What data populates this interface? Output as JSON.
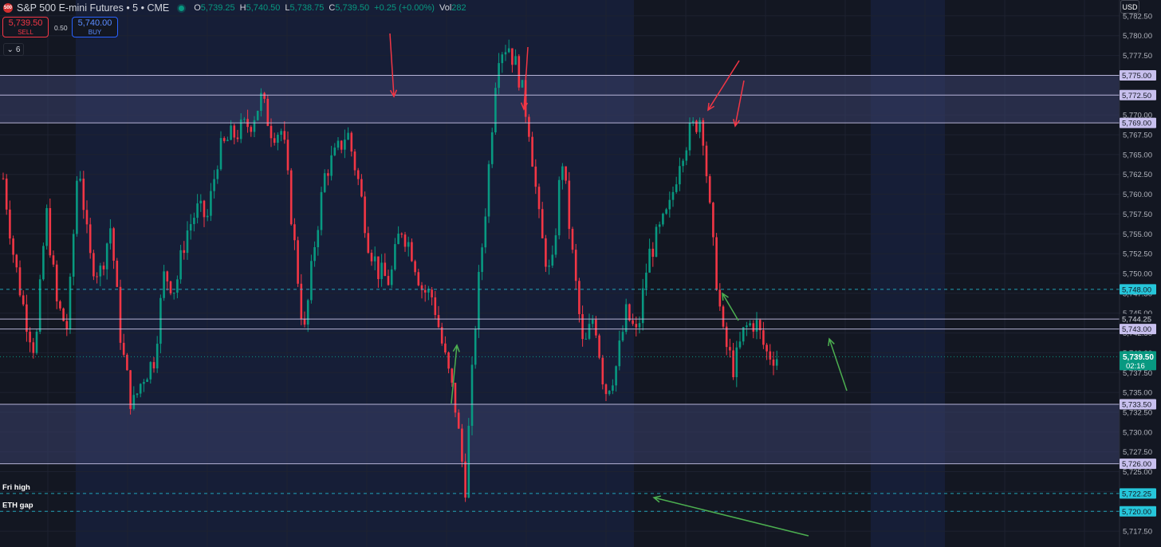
{
  "header": {
    "logo_text": "500",
    "symbol_title": "S&P 500 E-mini Futures • 5 • CME",
    "ohlc": {
      "o_label": "O",
      "o": "5,739.25",
      "h_label": "H",
      "h": "5,740.50",
      "l_label": "L",
      "l": "5,738.75",
      "c_label": "C",
      "c": "5,739.50",
      "change": "+0.25 (+0.00%)",
      "vol_label": "Vol",
      "vol": "282"
    }
  },
  "trade": {
    "sell_price": "5,739.50",
    "sell_label": "SELL",
    "spread": "0.50",
    "buy_price": "5,740.00",
    "buy_label": "BUY"
  },
  "indicators_toggle": {
    "count": "6"
  },
  "currency": "USD",
  "colors": {
    "bg": "#131722",
    "session": "#161e37",
    "up": "#089981",
    "down": "#f23645",
    "zone": "#3b3f6a",
    "level_line": "#c5c2e6",
    "dashed": "#26c6da",
    "arrow_red": "#f23645",
    "arrow_green": "#4caf50",
    "label_purple": "#c8c0ee",
    "label_teal": "#22ab94"
  },
  "chart_data": {
    "type": "candlestick",
    "instrument": "S&P 500 E-mini Futures",
    "timeframe": "5",
    "exchange": "CME",
    "ylim": [
      5715.5,
      5784.5
    ],
    "y_ticks": [
      "5,717.50",
      "5,720.00",
      "5,722.50",
      "5,725.00",
      "5,727.50",
      "5,730.00",
      "5,732.50",
      "5,735.00",
      "5,737.50",
      "5,740.00",
      "5,742.50",
      "5,745.00",
      "5,747.50",
      "5,750.00",
      "5,752.50",
      "5,755.00",
      "5,757.50",
      "5,760.00",
      "5,762.50",
      "5,765.00",
      "5,767.50",
      "5,770.00",
      "5,772.50",
      "5,775.00",
      "5,777.50",
      "5,780.00",
      "5,782.50"
    ],
    "y_tick_values": [
      5717.5,
      5720,
      5722.5,
      5725,
      5727.5,
      5730,
      5732.5,
      5735,
      5737.5,
      5740,
      5742.5,
      5745,
      5747.5,
      5750,
      5752.5,
      5755,
      5757.5,
      5760,
      5762.5,
      5765,
      5767.5,
      5770,
      5772.5,
      5775,
      5777.5,
      5780,
      5782.5
    ],
    "close_path": [
      5762,
      5752,
      5745,
      5740,
      5758,
      5746,
      5743,
      5765,
      5752,
      5750,
      5756,
      5741,
      5733,
      5737,
      5739,
      5750,
      5748,
      5755,
      5758,
      5757,
      5765,
      5767,
      5768,
      5769,
      5772,
      5768,
      5768,
      5755,
      5742,
      5754,
      5763,
      5765,
      5768,
      5762,
      5754,
      5750,
      5749,
      5756,
      5753,
      5748,
      5747,
      5740,
      5734,
      5723,
      5745,
      5760,
      5778,
      5779,
      5775,
      5768,
      5755,
      5749,
      5765,
      5752,
      5740,
      5745,
      5735,
      5738,
      5745,
      5742,
      5752,
      5755,
      5758,
      5765,
      5768,
      5770,
      5754,
      5742,
      5738,
      5743,
      5744,
      5740,
      5739.5
    ],
    "levels": [
      {
        "price": 5775.0,
        "label": "5,775.00",
        "style": "solid",
        "tag": "purple"
      },
      {
        "price": 5772.5,
        "label": "5,772.50",
        "style": "solid",
        "tag": "purple"
      },
      {
        "price": 5769.0,
        "label": "5,769.00",
        "style": "solid",
        "tag": "purple"
      },
      {
        "price": 5748.0,
        "label": "5,748.00",
        "style": "dashed",
        "tag": "teal"
      },
      {
        "price": 5744.25,
        "label": "5,744.25",
        "style": "solid",
        "tag": "none"
      },
      {
        "price": 5743.0,
        "label": "5,743.00",
        "style": "solid",
        "tag": "purple"
      },
      {
        "price": 5733.5,
        "label": "5,733.50",
        "style": "solid",
        "tag": "purple"
      },
      {
        "price": 5726.0,
        "label": "5,726.00",
        "style": "solid",
        "tag": "purple"
      },
      {
        "price": 5722.25,
        "label": "5,722.25",
        "style": "dashed",
        "tag": "teal"
      },
      {
        "price": 5720.0,
        "label": "5,720.00",
        "style": "dashed",
        "tag": "teal"
      }
    ],
    "zones": [
      {
        "from": 5769.0,
        "to": 5775.0
      },
      {
        "from": 5726.0,
        "to": 5733.5
      }
    ],
    "last_price": {
      "price": 5739.5,
      "label": "5,739.50",
      "countdown": "02:16"
    },
    "annotations": [
      {
        "text": "Fri high",
        "price": 5722.25
      },
      {
        "text": "ETH gap",
        "price": 5720.0
      }
    ]
  }
}
